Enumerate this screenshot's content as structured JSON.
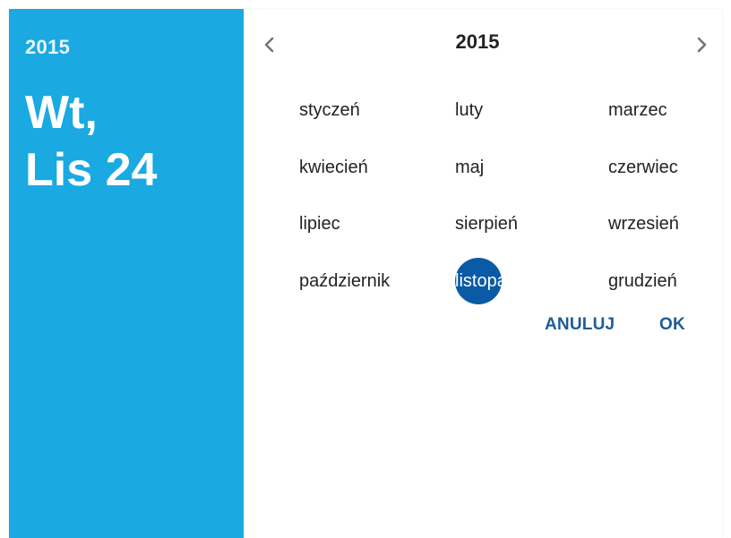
{
  "header": {
    "year": "2015",
    "weekday": "Wt,",
    "date": "Lis 24"
  },
  "navigator": {
    "year": "2015",
    "prev_icon": "chevron-left-icon",
    "next_icon": "chevron-right-icon"
  },
  "months": [
    "styczeń",
    "luty",
    "marzec",
    "kwiecień",
    "maj",
    "czerwiec",
    "lipiec",
    "sierpień",
    "wrzesień",
    "październik",
    "listopad",
    "grudzień"
  ],
  "selected_month": "listopad",
  "actions": {
    "cancel_label": "ANULUJ",
    "ok_label": "OK"
  },
  "colors": {
    "header_background": "#1aa9e1",
    "selected_circle": "#0a5aa5",
    "action_text": "#1e5c96"
  }
}
